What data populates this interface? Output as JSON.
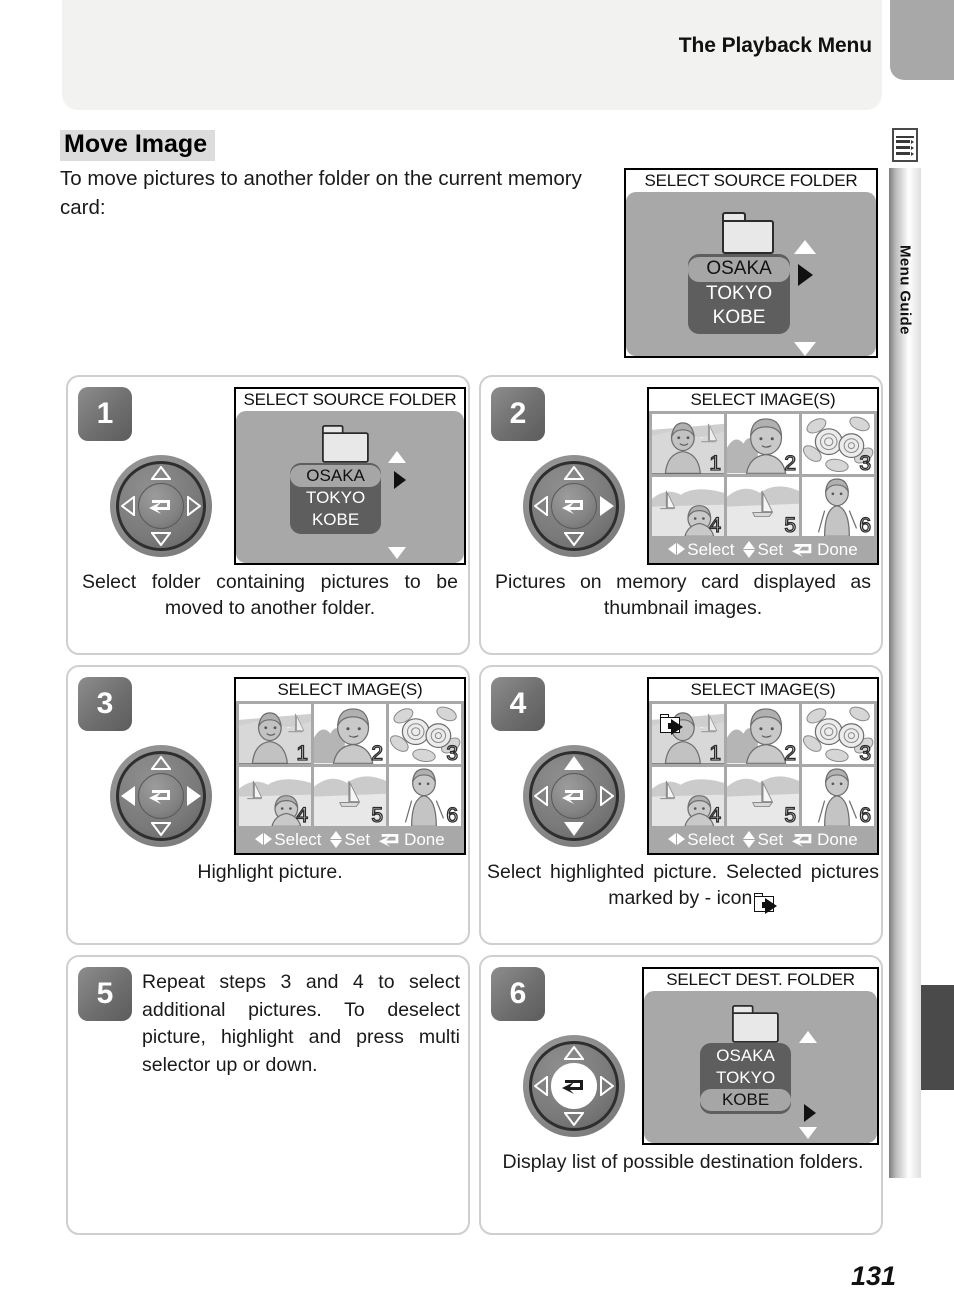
{
  "header": {
    "title": "The Playback Menu"
  },
  "side_tab": {
    "label": "Menu Guide",
    "icon": "menu-list-icon"
  },
  "section": {
    "heading": "Move Image",
    "intro": "To move pictures to another folder on the current memory card:"
  },
  "hero_screen": {
    "title": "SELECT SOURCE FOLDER",
    "folders": [
      "OSAKA",
      "TOKYO",
      "KOBE"
    ],
    "selected": "OSAKA",
    "arrows": [
      "up",
      "down",
      "right"
    ]
  },
  "thumbnail_bar": {
    "select_label": "Select",
    "set_label": "Set",
    "done_label": "Done"
  },
  "thumbnails": [
    {
      "num": "1",
      "subject": "woman-portrait"
    },
    {
      "num": "2",
      "subject": "boy-portrait"
    },
    {
      "num": "3",
      "subject": "flowers"
    },
    {
      "num": "4",
      "subject": "boy-at-lake"
    },
    {
      "num": "5",
      "subject": "sailboat-landscape"
    },
    {
      "num": "6",
      "subject": "woman-standing"
    }
  ],
  "steps": [
    {
      "number": "1",
      "caption": "Select folder containing pictures to be moved to another folder.",
      "screen": {
        "kind": "folder-picker",
        "title": "SELECT SOURCE FOLDER",
        "folders": [
          "OSAKA",
          "TOKYO",
          "KOBE"
        ],
        "selected": "OSAKA"
      },
      "dial": {
        "up": false,
        "down": false,
        "left": false,
        "right": false,
        "center": false
      }
    },
    {
      "number": "2",
      "caption": "Pictures on memory card displayed as thumbnail images.",
      "screen": {
        "kind": "thumbnail-grid",
        "title": "SELECT IMAGE(S)",
        "highlighted": "1",
        "marked": []
      },
      "dial": {
        "up": false,
        "down": false,
        "left": false,
        "right": false,
        "center": false
      }
    },
    {
      "number": "3",
      "caption": "Highlight picture.",
      "screen": {
        "kind": "thumbnail-grid",
        "title": "SELECT IMAGE(S)",
        "highlighted": "1",
        "marked": []
      },
      "dial": {
        "up": false,
        "down": false,
        "left": true,
        "right": true,
        "center": false
      }
    },
    {
      "number": "4",
      "caption": "Select highlighted picture.  Selected pictures marked by      - icon.",
      "screen": {
        "kind": "thumbnail-grid",
        "title": "SELECT IMAGE(S)",
        "highlighted": "1",
        "marked": [
          "1"
        ]
      },
      "dial": {
        "up": true,
        "down": true,
        "left": false,
        "right": false,
        "center": false
      }
    },
    {
      "number": "5",
      "caption": "Repeat steps 3 and 4 to select additional pictures.  To deselect picture, highlight and press multi selector up or down.",
      "screen": {
        "kind": "none"
      },
      "dial": null
    },
    {
      "number": "6",
      "caption": "Display list of possible destination folders.",
      "screen": {
        "kind": "folder-picker",
        "title": "SELECT DEST. FOLDER",
        "folders": [
          "OSAKA",
          "TOKYO",
          "KOBE"
        ],
        "selected": "KOBE"
      },
      "dial": {
        "up": false,
        "down": false,
        "left": false,
        "right": false,
        "center": true
      }
    }
  ],
  "page_number": "131",
  "colors": {
    "lcd_background": "#a8a8a8",
    "lcd_list": "#5e5e5e",
    "lcd_highlight": "#a6a6a6",
    "heading_highlight": "#dcdcdc",
    "header_band": "#f2f2f0",
    "badge_dark": "#5c5c5c"
  }
}
